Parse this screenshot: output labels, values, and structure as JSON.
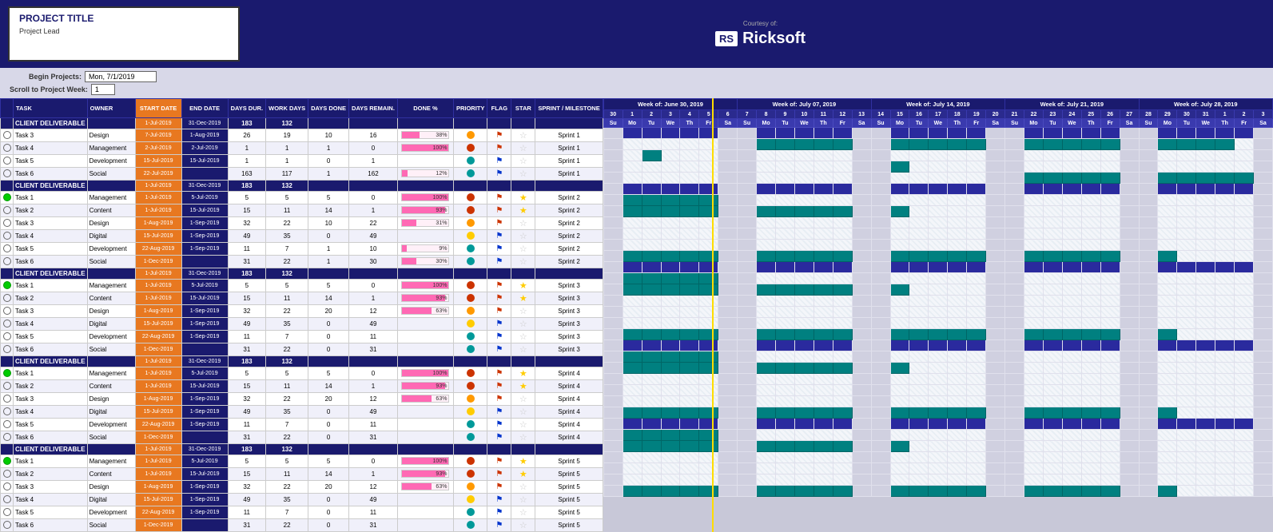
{
  "header": {
    "courtesy_label": "Courtesy of:",
    "brand_rs": "RS",
    "brand_name": "Ricksoft"
  },
  "project": {
    "title": "PROJECT TITLE",
    "lead_label": "Project Lead",
    "begin_projects_label": "Begin Projects:",
    "begin_projects_value": "Mon, 7/1/2019",
    "scroll_label": "Scroll to Project Week:",
    "scroll_value": "1"
  },
  "columns": {
    "task": "TASK",
    "owner": "OWNER",
    "start_date": "START DATE",
    "end_date": "END DATE",
    "days_duration": "DAYS DURATION",
    "work_days": "WORK DAYS",
    "days_done": "DAYS DONE",
    "days_remaining": "DAYS REMAINING",
    "done_pct": "DONE %",
    "priority": "PRIORITY",
    "flag": "FLAG",
    "star": "STAR",
    "sprint": "SPRINT / MILESTONE"
  },
  "weeks": [
    "Week of: June 30, 2019",
    "Week of: July 07, 2019",
    "Week of: July 14, 2019",
    "Week of: July 21, 2019",
    "Week of: July 28, 2019"
  ],
  "sprints": [
    {
      "type": "section",
      "label": "CLIENT DELIVERABLE",
      "start": "1-Jul-2019",
      "end": "31-Dec-2019",
      "days": "183",
      "work_days": "132",
      "tasks": [
        {
          "name": "Task 3",
          "owner": "Design",
          "start": "7-Jul-2019",
          "end": "1-Aug-2019",
          "days": 26,
          "work": 19,
          "done_days": 10,
          "remaining": 16,
          "pct": 38,
          "priority": "orange",
          "flag": "red",
          "star": false,
          "sprint": "Sprint 1",
          "status": "empty"
        },
        {
          "name": "Task 4",
          "owner": "Management",
          "start": "2-Jul-2019",
          "end": "2-Jul-2019",
          "days": 1,
          "work": 1,
          "done_days": 1,
          "remaining": 0,
          "pct": 100,
          "priority": "red",
          "flag": "red",
          "star": false,
          "sprint": "Sprint 1",
          "status": "empty"
        },
        {
          "name": "Task 5",
          "owner": "Development",
          "start": "15-Jul-2019",
          "end": "15-Jul-2019",
          "days": 1,
          "work": 1,
          "done_days": 0,
          "remaining": 1,
          "pct": 0,
          "priority": "teal",
          "flag": "blue",
          "star": false,
          "sprint": "Sprint 1",
          "status": "empty"
        },
        {
          "name": "Task 6",
          "owner": "Social",
          "start": "22-Jul-2019",
          "end": "",
          "days": 163,
          "work": 117,
          "done_days": 1,
          "remaining": 162,
          "pct": 12,
          "priority": "teal",
          "flag": "blue",
          "star": false,
          "sprint": "Sprint 1",
          "status": "empty"
        }
      ]
    },
    {
      "type": "section",
      "label": "CLIENT DELIVERABLE",
      "start": "1-Jul-2019",
      "end": "31-Dec-2019",
      "days": "183",
      "work_days": "132",
      "tasks": [
        {
          "name": "Task 1",
          "owner": "Management",
          "start": "1-Jul-2019",
          "end": "5-Jul-2019",
          "days": 5,
          "work": 5,
          "done_days": 5,
          "remaining": 0,
          "pct": 100,
          "priority": "red",
          "flag": "red",
          "star": true,
          "sprint": "Sprint 2",
          "status": "green"
        },
        {
          "name": "Task 2",
          "owner": "Content",
          "start": "1-Jul-2019",
          "end": "15-Jul-2019",
          "days": 15,
          "work": 11,
          "done_days": 14,
          "remaining": 1,
          "pct": 93,
          "priority": "red",
          "flag": "red",
          "star": true,
          "sprint": "Sprint 2",
          "status": "empty"
        },
        {
          "name": "Task 3",
          "owner": "Design",
          "start": "1-Aug-2019",
          "end": "1-Sep-2019",
          "days": 32,
          "work": 22,
          "done_days": 10,
          "remaining": 22,
          "pct": 31,
          "priority": "orange",
          "flag": "red",
          "star": false,
          "sprint": "Sprint 2",
          "status": "empty"
        },
        {
          "name": "Task 4",
          "owner": "Digital",
          "start": "15-Jul-2019",
          "end": "1-Sep-2019",
          "days": 49,
          "work": 35,
          "done_days": 0,
          "remaining": 49,
          "pct": 0,
          "priority": "yellow",
          "flag": "blue",
          "star": false,
          "sprint": "Sprint 2",
          "status": "empty"
        },
        {
          "name": "Task 5",
          "owner": "Development",
          "start": "22-Aug-2019",
          "end": "1-Sep-2019",
          "days": 11,
          "work": 7,
          "done_days": 1,
          "remaining": 10,
          "pct": 9,
          "priority": "teal",
          "flag": "blue",
          "star": false,
          "sprint": "Sprint 2",
          "status": "empty"
        },
        {
          "name": "Task 6",
          "owner": "Social",
          "start": "1-Dec-2019",
          "end": "",
          "days": 31,
          "work": 22,
          "done_days": 1,
          "remaining": 30,
          "pct": 30,
          "priority": "teal",
          "flag": "blue",
          "star": false,
          "sprint": "Sprint 2",
          "status": "empty"
        }
      ]
    },
    {
      "type": "section",
      "label": "CLIENT DELIVERABLE",
      "start": "1-Jul-2019",
      "end": "31-Dec-2019",
      "days": "183",
      "work_days": "132",
      "tasks": [
        {
          "name": "Task 1",
          "owner": "Management",
          "start": "1-Jul-2019",
          "end": "5-Jul-2019",
          "days": 5,
          "work": 5,
          "done_days": 5,
          "remaining": 0,
          "pct": 100,
          "priority": "red",
          "flag": "red",
          "star": true,
          "sprint": "Sprint 3",
          "status": "green"
        },
        {
          "name": "Task 2",
          "owner": "Content",
          "start": "1-Jul-2019",
          "end": "15-Jul-2019",
          "days": 15,
          "work": 11,
          "done_days": 14,
          "remaining": 1,
          "pct": 93,
          "priority": "red",
          "flag": "red",
          "star": true,
          "sprint": "Sprint 3",
          "status": "empty"
        },
        {
          "name": "Task 3",
          "owner": "Design",
          "start": "1-Aug-2019",
          "end": "1-Sep-2019",
          "days": 32,
          "work": 22,
          "done_days": 20,
          "remaining": 12,
          "pct": 63,
          "priority": "orange",
          "flag": "red",
          "star": false,
          "sprint": "Sprint 3",
          "status": "empty"
        },
        {
          "name": "Task 4",
          "owner": "Digital",
          "start": "15-Jul-2019",
          "end": "1-Sep-2019",
          "days": 49,
          "work": 35,
          "done_days": 0,
          "remaining": 49,
          "pct": 0,
          "priority": "yellow",
          "flag": "blue",
          "star": false,
          "sprint": "Sprint 3",
          "status": "empty"
        },
        {
          "name": "Task 5",
          "owner": "Development",
          "start": "22-Aug-2019",
          "end": "1-Sep-2019",
          "days": 11,
          "work": 7,
          "done_days": 0,
          "remaining": 11,
          "pct": 0,
          "priority": "teal",
          "flag": "blue",
          "star": false,
          "sprint": "Sprint 3",
          "status": "empty"
        },
        {
          "name": "Task 6",
          "owner": "Social",
          "start": "1-Dec-2019",
          "end": "",
          "days": 31,
          "work": 22,
          "done_days": 0,
          "remaining": 31,
          "pct": 0,
          "priority": "teal",
          "flag": "blue",
          "star": false,
          "sprint": "Sprint 3",
          "status": "empty"
        }
      ]
    },
    {
      "type": "section",
      "label": "CLIENT DELIVERABLE",
      "start": "1-Jul-2019",
      "end": "31-Dec-2019",
      "days": "183",
      "work_days": "132",
      "tasks": [
        {
          "name": "Task 1",
          "owner": "Management",
          "start": "1-Jul-2019",
          "end": "5-Jul-2019",
          "days": 5,
          "work": 5,
          "done_days": 5,
          "remaining": 0,
          "pct": 100,
          "priority": "red",
          "flag": "red",
          "star": true,
          "sprint": "Sprint 4",
          "status": "green"
        },
        {
          "name": "Task 2",
          "owner": "Content",
          "start": "1-Jul-2019",
          "end": "15-Jul-2019",
          "days": 15,
          "work": 11,
          "done_days": 14,
          "remaining": 1,
          "pct": 93,
          "priority": "red",
          "flag": "red",
          "star": true,
          "sprint": "Sprint 4",
          "status": "empty"
        },
        {
          "name": "Task 3",
          "owner": "Design",
          "start": "1-Aug-2019",
          "end": "1-Sep-2019",
          "days": 32,
          "work": 22,
          "done_days": 20,
          "remaining": 12,
          "pct": 63,
          "priority": "orange",
          "flag": "red",
          "star": false,
          "sprint": "Sprint 4",
          "status": "empty"
        },
        {
          "name": "Task 4",
          "owner": "Digital",
          "start": "15-Jul-2019",
          "end": "1-Sep-2019",
          "days": 49,
          "work": 35,
          "done_days": 0,
          "remaining": 49,
          "pct": 0,
          "priority": "yellow",
          "flag": "blue",
          "star": false,
          "sprint": "Sprint 4",
          "status": "empty"
        },
        {
          "name": "Task 5",
          "owner": "Development",
          "start": "22-Aug-2019",
          "end": "1-Sep-2019",
          "days": 11,
          "work": 7,
          "done_days": 0,
          "remaining": 11,
          "pct": 0,
          "priority": "teal",
          "flag": "blue",
          "star": false,
          "sprint": "Sprint 4",
          "status": "empty"
        },
        {
          "name": "Task 6",
          "owner": "Social",
          "start": "1-Dec-2019",
          "end": "",
          "days": 31,
          "work": 22,
          "done_days": 0,
          "remaining": 31,
          "pct": 0,
          "priority": "teal",
          "flag": "blue",
          "star": false,
          "sprint": "Sprint 4",
          "status": "empty"
        }
      ]
    },
    {
      "type": "section",
      "label": "CLIENT DELIVERABLE",
      "start": "1-Jul-2019",
      "end": "31-Dec-2019",
      "days": "183",
      "work_days": "132",
      "tasks": [
        {
          "name": "Task 1",
          "owner": "Management",
          "start": "1-Jul-2019",
          "end": "5-Jul-2019",
          "days": 5,
          "work": 5,
          "done_days": 5,
          "remaining": 0,
          "pct": 100,
          "priority": "red",
          "flag": "red",
          "star": true,
          "sprint": "Sprint 5",
          "status": "green"
        },
        {
          "name": "Task 2",
          "owner": "Content",
          "start": "1-Jul-2019",
          "end": "15-Jul-2019",
          "days": 15,
          "work": 11,
          "done_days": 14,
          "remaining": 1,
          "pct": 93,
          "priority": "red",
          "flag": "red",
          "star": true,
          "sprint": "Sprint 5",
          "status": "empty"
        },
        {
          "name": "Task 3",
          "owner": "Design",
          "start": "1-Aug-2019",
          "end": "1-Sep-2019",
          "days": 32,
          "work": 22,
          "done_days": 20,
          "remaining": 12,
          "pct": 63,
          "priority": "orange",
          "flag": "red",
          "star": false,
          "sprint": "Sprint 5",
          "status": "empty"
        },
        {
          "name": "Task 4",
          "owner": "Digital",
          "start": "15-Jul-2019",
          "end": "1-Sep-2019",
          "days": 49,
          "work": 35,
          "done_days": 0,
          "remaining": 49,
          "pct": 0,
          "priority": "yellow",
          "flag": "blue",
          "star": false,
          "sprint": "Sprint 5",
          "status": "empty"
        },
        {
          "name": "Task 5",
          "owner": "Development",
          "start": "22-Aug-2019",
          "end": "1-Sep-2019",
          "days": 11,
          "work": 7,
          "done_days": 0,
          "remaining": 11,
          "pct": 0,
          "priority": "teal",
          "flag": "blue",
          "star": false,
          "sprint": "Sprint 5",
          "status": "empty"
        },
        {
          "name": "Task 6",
          "owner": "Social",
          "start": "1-Dec-2019",
          "end": "",
          "days": 31,
          "work": 22,
          "done_days": 0,
          "remaining": 31,
          "pct": 0,
          "priority": "teal",
          "flag": "blue",
          "star": false,
          "sprint": "Sprint 5",
          "status": "empty"
        }
      ]
    }
  ],
  "gantt": {
    "week1_days": [
      30,
      1,
      2,
      3,
      4,
      5,
      6
    ],
    "week1_abbr": [
      "Su",
      "Mo",
      "Tu",
      "We",
      "Th",
      "Fr",
      "Sa"
    ],
    "week2_days": [
      7,
      8,
      9,
      10,
      11,
      12,
      13
    ],
    "week2_abbr": [
      "Su",
      "Mo",
      "Tu",
      "We",
      "Th",
      "Fr",
      "Sa"
    ],
    "week3_days": [
      14,
      15,
      16,
      17,
      18,
      19,
      20
    ],
    "week3_abbr": [
      "Su",
      "Mo",
      "Tu",
      "We",
      "Th",
      "Fr",
      "Sa"
    ],
    "week4_days": [
      21,
      22,
      23,
      24,
      25,
      26,
      27
    ],
    "week4_abbr": [
      "Su",
      "Mo",
      "Tu",
      "We",
      "Th",
      "Fr",
      "Sa"
    ],
    "week5_days": [
      28,
      29,
      30,
      31,
      1,
      2,
      3
    ],
    "week5_abbr": [
      "Su",
      "Mo",
      "Tu",
      "We",
      "Th",
      "Fr",
      "Sa"
    ]
  }
}
